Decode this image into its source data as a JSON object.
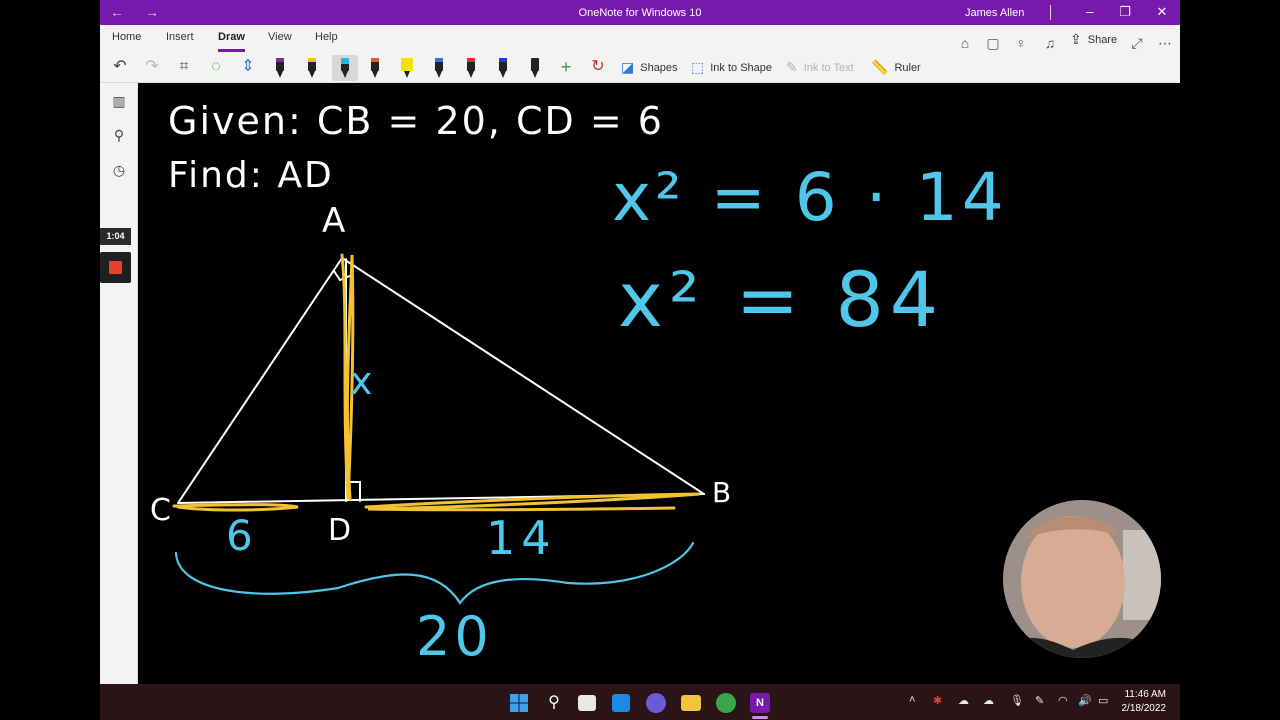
{
  "window": {
    "title": "OneNote for Windows 10",
    "user": "James Allen",
    "back_glyph": "←",
    "forward_glyph": "→",
    "minimize_glyph": "–",
    "restore_glyph": "❐",
    "close_glyph": "✕"
  },
  "ribbon": {
    "tabs": [
      {
        "label": "Home"
      },
      {
        "label": "Insert"
      },
      {
        "label": "Draw",
        "active": true
      },
      {
        "label": "View"
      },
      {
        "label": "Help"
      }
    ],
    "share_label": "Share",
    "shapes_label": "Shapes",
    "ink_to_shape_label": "Ink to Shape",
    "ink_to_text_label": "Ink to Text",
    "ruler_label": "Ruler",
    "pen_colors": [
      "#7a2a9a",
      "#f4c020",
      "#24b5e0",
      "#e06020",
      "#f6e200",
      "#2a7ad6",
      "#e03030",
      "#2a3ad6",
      "#222222"
    ],
    "accent": "#7719aa"
  },
  "recording": {
    "timer": "1:04"
  },
  "note": {
    "given": "Given: CB = 20, CD = 6",
    "find": "Find: AD",
    "vertex_a": "A",
    "vertex_b": "B",
    "vertex_c": "C",
    "vertex_d": "D",
    "label_x": "x",
    "seg_cd": "6",
    "seg_db": "14",
    "seg_cb": "20",
    "eq1": "x² = 6 · 14",
    "eq2": "x² = 84",
    "ink_white": "#ffffff",
    "ink_yellow": "#f2c233",
    "ink_blue": "#4fc6ea"
  },
  "taskbar": {
    "time": "11:46 AM",
    "date": "2/18/2022",
    "accent": "#0078d4"
  }
}
